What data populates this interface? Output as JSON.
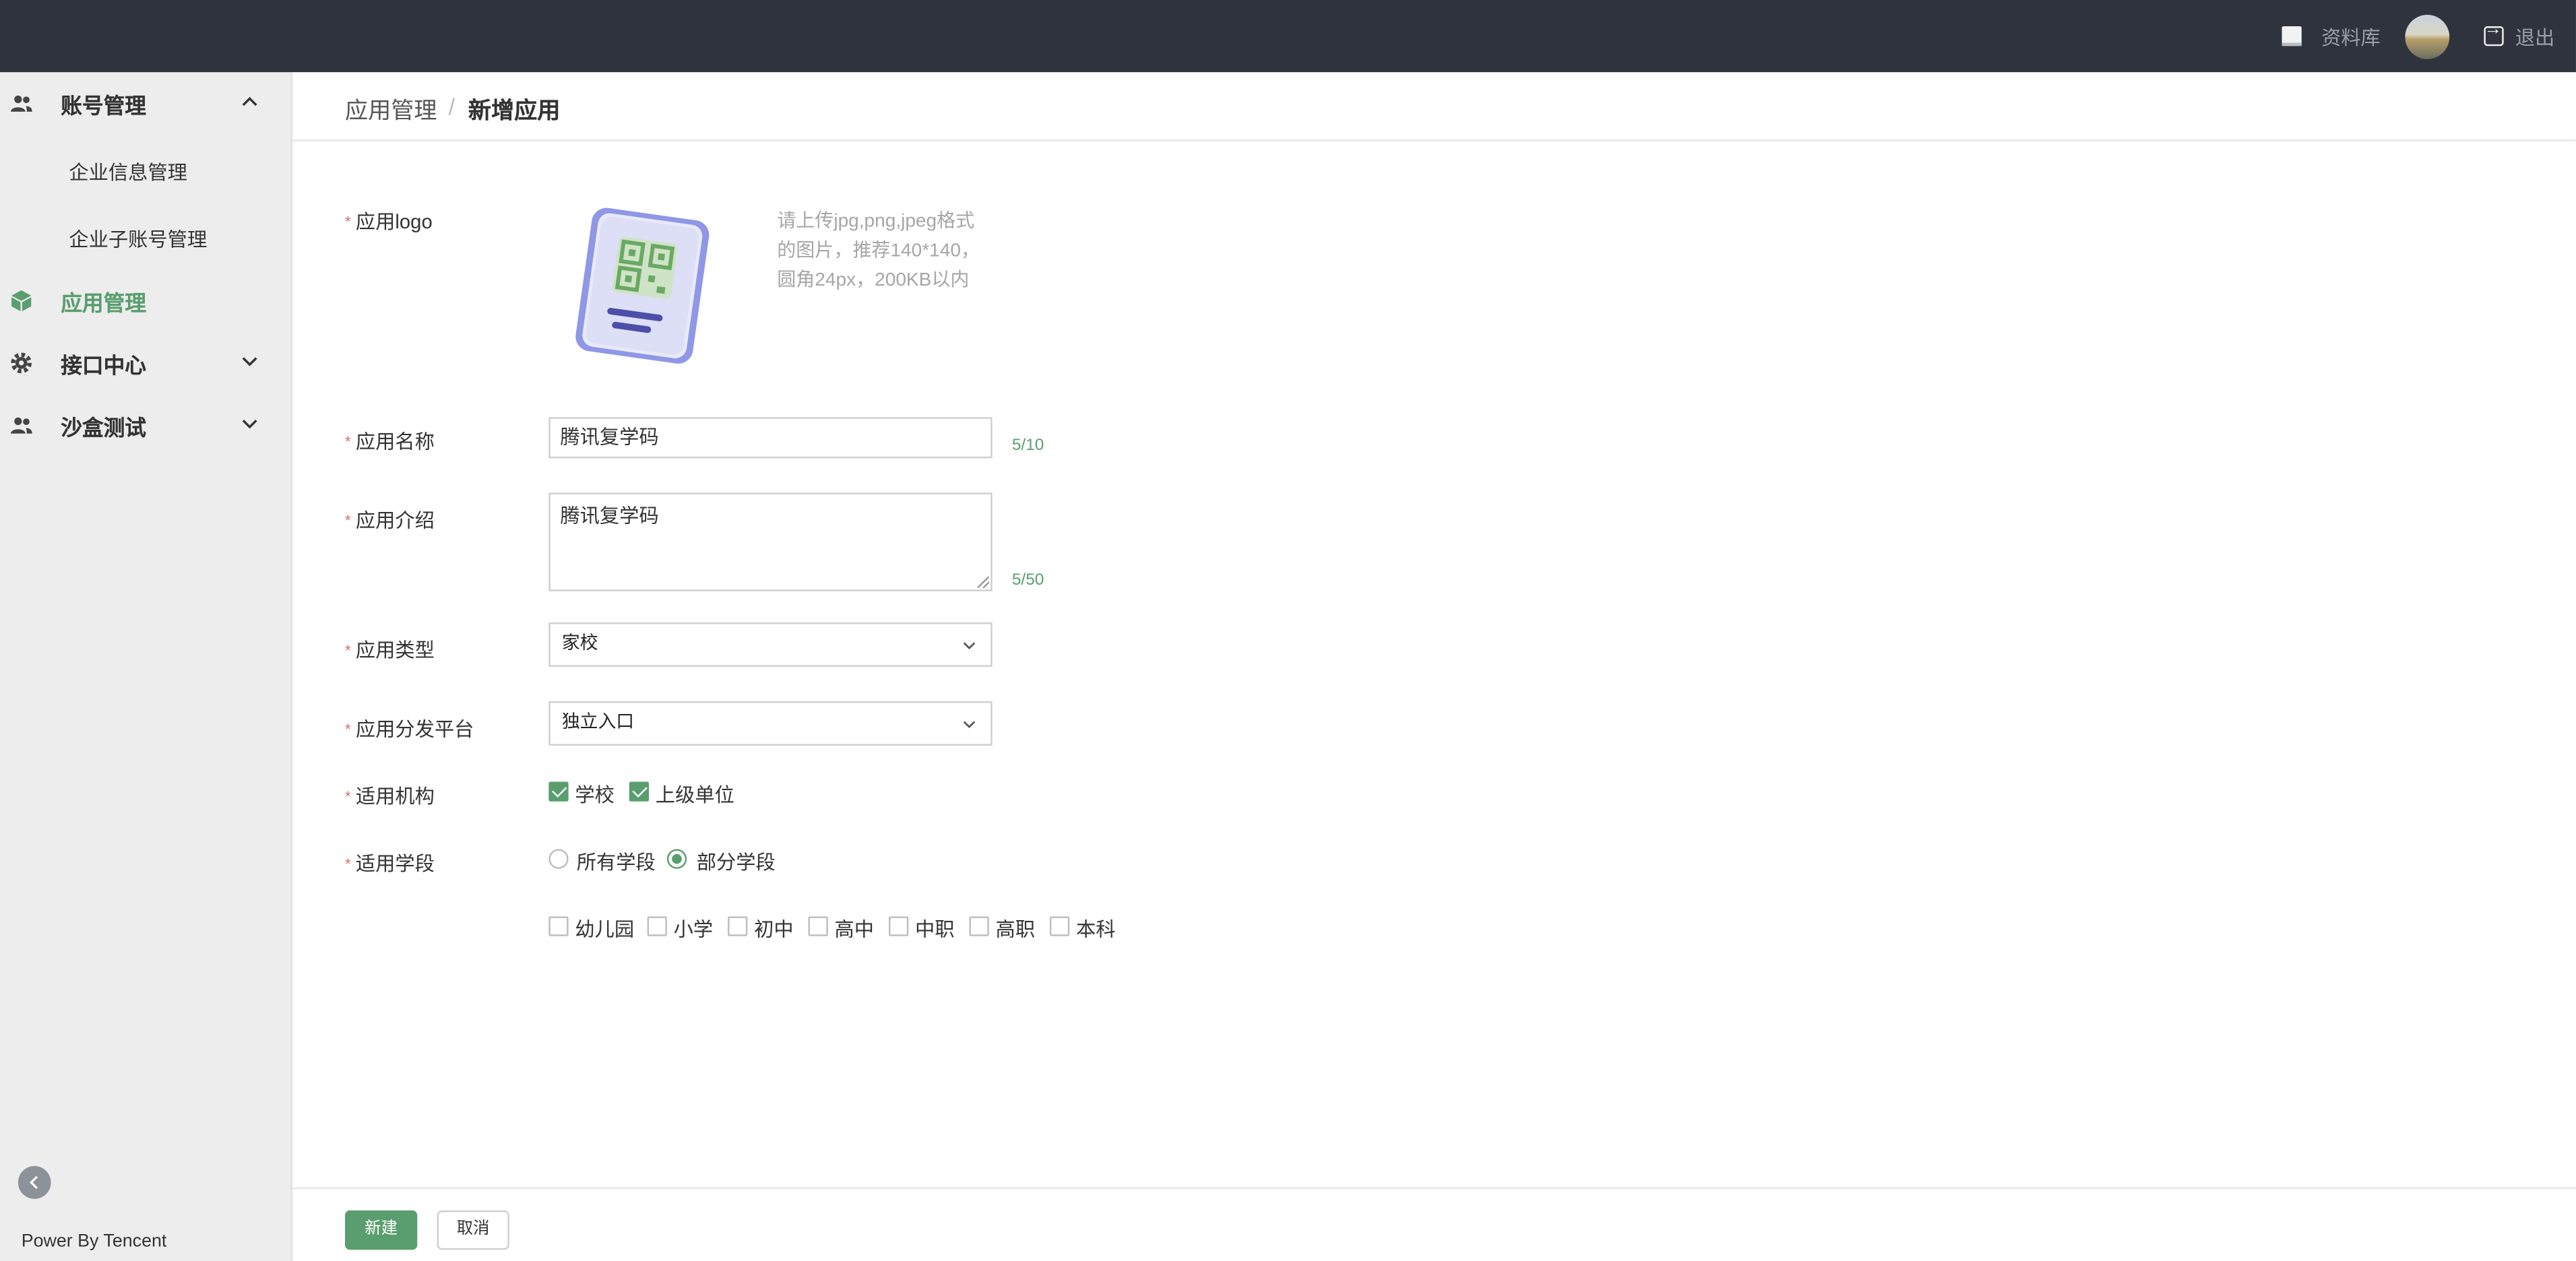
{
  "topbar": {
    "docs_label": "资料库",
    "logout_label": "退出"
  },
  "sidebar": {
    "account_group": "账号管理",
    "account_items": [
      "企业信息管理",
      "企业子账号管理"
    ],
    "app_manage": "应用管理",
    "api_center": "接口中心",
    "sandbox": "沙盒测试",
    "footer_text": "Power By Tencent"
  },
  "breadcrumb": {
    "parent": "应用管理",
    "separator": "/",
    "current": "新增应用"
  },
  "form": {
    "logo_label": "应用logo",
    "logo_hint": "请上传jpg,png,jpeg格式的图片，推荐140*140，圆角24px，200KB以内",
    "name_label": "应用名称",
    "name_value": "腾讯复学码",
    "name_counter": "5/10",
    "desc_label": "应用介绍",
    "desc_value": "腾讯复学码",
    "desc_counter": "5/50",
    "type_label": "应用类型",
    "type_value": "家校",
    "platform_label": "应用分发平台",
    "platform_value": "独立入口",
    "org_label": "适用机构",
    "org_options": [
      {
        "label": "学校",
        "checked": true
      },
      {
        "label": "上级单位",
        "checked": true
      }
    ],
    "stage_label": "适用学段",
    "stage_radio": [
      {
        "label": "所有学段",
        "selected": false
      },
      {
        "label": "部分学段",
        "selected": true
      }
    ],
    "stage_options": [
      {
        "label": "幼儿园",
        "checked": false
      },
      {
        "label": "小学",
        "checked": false
      },
      {
        "label": "初中",
        "checked": false
      },
      {
        "label": "高中",
        "checked": false
      },
      {
        "label": "中职",
        "checked": false
      },
      {
        "label": "高职",
        "checked": false
      },
      {
        "label": "本科",
        "checked": false
      }
    ]
  },
  "actions": {
    "submit_label": "新建",
    "cancel_label": "取消"
  },
  "colors": {
    "accent": "#5a9e6f",
    "topbar": "#2f333d",
    "sidebar": "#ededed",
    "required": "#e0686a"
  }
}
